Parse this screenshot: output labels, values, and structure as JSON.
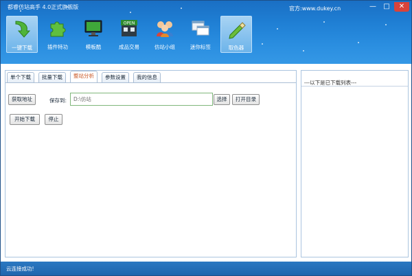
{
  "app": {
    "title": "都睿仿站高手 4.0正式旗舰版",
    "website": "官方:www.dukey.cn"
  },
  "window_controls": {
    "minimize": "—",
    "maximize": "□",
    "close": "✕"
  },
  "toolbar": {
    "items": [
      {
        "label": "一键下载",
        "icon": "download-arrow-icon",
        "active": true
      },
      {
        "label": "插件特功",
        "icon": "puzzle-icon",
        "active": false
      },
      {
        "label": "模板酷",
        "icon": "monitor-icon",
        "active": false
      },
      {
        "label": "成品交易",
        "icon": "open-shop-icon",
        "active": false
      },
      {
        "label": "仿站小组",
        "icon": "people-group-icon",
        "active": false
      },
      {
        "label": "迷你标签",
        "icon": "windows-icon",
        "active": false
      },
      {
        "label": "取色器",
        "icon": "eyedropper-icon",
        "active": true
      }
    ]
  },
  "tabs": [
    {
      "label": "单个下载",
      "active": false
    },
    {
      "label": "批量下载",
      "active": false
    },
    {
      "label": "整站分析",
      "active": true
    },
    {
      "label": "参数设置",
      "active": false
    },
    {
      "label": "我的信息",
      "active": false
    }
  ],
  "form": {
    "get_address_button": "获取地址",
    "save_to_label": "保存到:",
    "save_path_value": "D:\\仿站",
    "choose_button": "选择",
    "open_dir_button": "打开目录",
    "start_download_button": "开始下载",
    "stop_button": "停止"
  },
  "download_list": {
    "header": "---以下是已下载列表---"
  },
  "status": {
    "text": "云连接成功!"
  }
}
